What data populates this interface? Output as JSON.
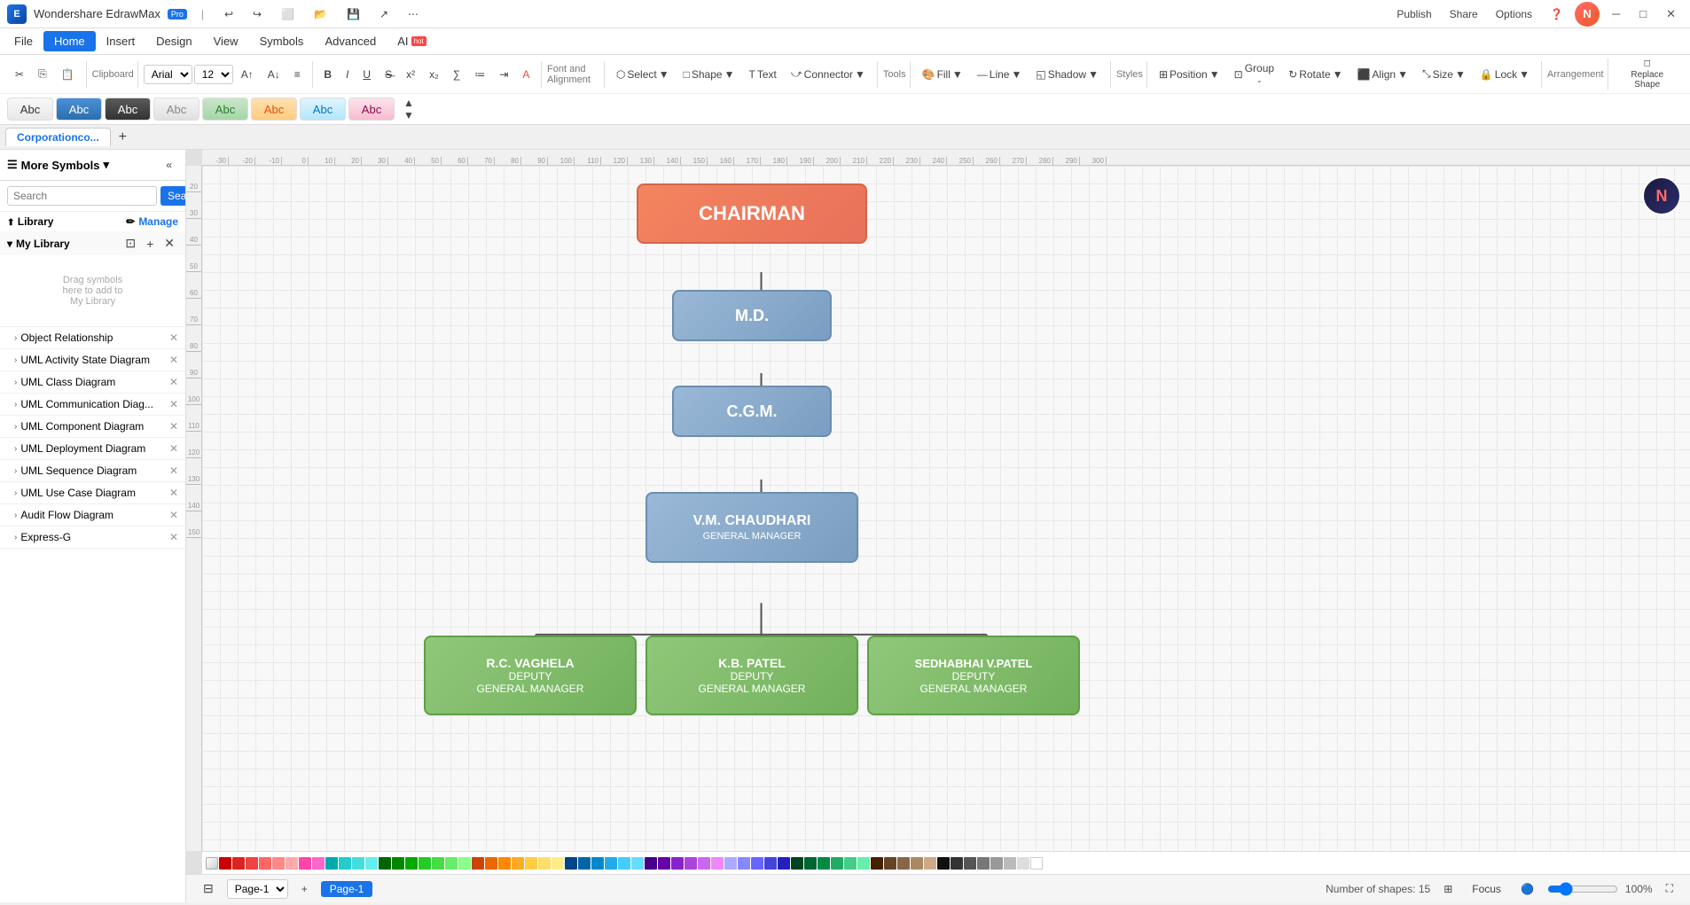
{
  "app": {
    "name": "Wondershare EdrawMax",
    "tier": "Pro",
    "title": "Corporationco...",
    "tab": "Corporationco..."
  },
  "menu": {
    "items": [
      "File",
      "Home",
      "Insert",
      "Design",
      "View",
      "Symbols",
      "Advanced",
      "AI"
    ]
  },
  "toolbar": {
    "font_family": "Arial",
    "font_size": "12",
    "select_label": "Select",
    "shape_label": "Shape",
    "text_label": "Text",
    "connector_label": "Connector",
    "fill_label": "Fill",
    "line_label": "Line",
    "shadow_label": "Shadow",
    "position_label": "Position",
    "align_label": "Align",
    "group_label": "Group -",
    "size_label": "Size",
    "rotate_label": "Rotate",
    "lock_label": "Lock",
    "replace_label": "Replace Shape",
    "publish_label": "Publish",
    "share_label": "Share",
    "options_label": "Options"
  },
  "sidebar": {
    "more_symbols_label": "More Symbols",
    "search_placeholder": "Search",
    "search_btn": "Search",
    "library_label": "Library",
    "manage_label": "Manage",
    "my_library_label": "My Library",
    "drag_hint": "Drag symbols\nhere to add to\nMy Library",
    "items": [
      {
        "label": "Object Relationship",
        "id": "object-relationship"
      },
      {
        "label": "UML Activity State Diagram",
        "id": "uml-activity"
      },
      {
        "label": "UML Class Diagram",
        "id": "uml-class"
      },
      {
        "label": "UML Communication Diag...",
        "id": "uml-communication"
      },
      {
        "label": "UML Component Diagram",
        "id": "uml-component"
      },
      {
        "label": "UML Deployment Diagram",
        "id": "uml-deployment"
      },
      {
        "label": "UML Sequence Diagram",
        "id": "uml-sequence"
      },
      {
        "label": "UML Use Case Diagram",
        "id": "uml-usecase"
      },
      {
        "label": "Audit Flow Diagram",
        "id": "audit-flow"
      },
      {
        "label": "Express-G",
        "id": "express-g"
      }
    ]
  },
  "shapes_row": {
    "items": [
      "Abc",
      "Abc",
      "Abc",
      "Abc",
      "Abc",
      "Abc",
      "Abc",
      "Abc"
    ]
  },
  "diagram": {
    "chairman": "CHAIRMAN",
    "md": "M.D.",
    "cgm": "C.G.M.",
    "vm_name": "V.M. CHAUDHARI",
    "vm_title": "GENERAL MANAGER",
    "rc_name": "R.C. VAGHELA",
    "rc_title": "DEPUTY",
    "rc_subtitle": "GENERAL MANAGER",
    "kb_name": "K.B. PATEL",
    "kb_title": "DEPUTY",
    "kb_subtitle": "GENERAL MANAGER",
    "sed_name": "SEDHABHAI V.PATEL",
    "sed_title": "DEPUTY",
    "sed_subtitle": "GENERAL MANAGER"
  },
  "status_bar": {
    "page_label": "Page-1",
    "shapes_count": "Number of shapes: 15",
    "zoom_level": "100%",
    "focus_label": "Focus"
  },
  "tabs": [
    {
      "label": "Page-1",
      "active": true
    }
  ],
  "colors": {
    "chairman_bg": "#F4845F",
    "md_bg": "#8BAFD4",
    "cgm_bg": "#8BAFD4",
    "vm_bg": "#8BAFD4",
    "deputy_bg": "#90C87A"
  }
}
